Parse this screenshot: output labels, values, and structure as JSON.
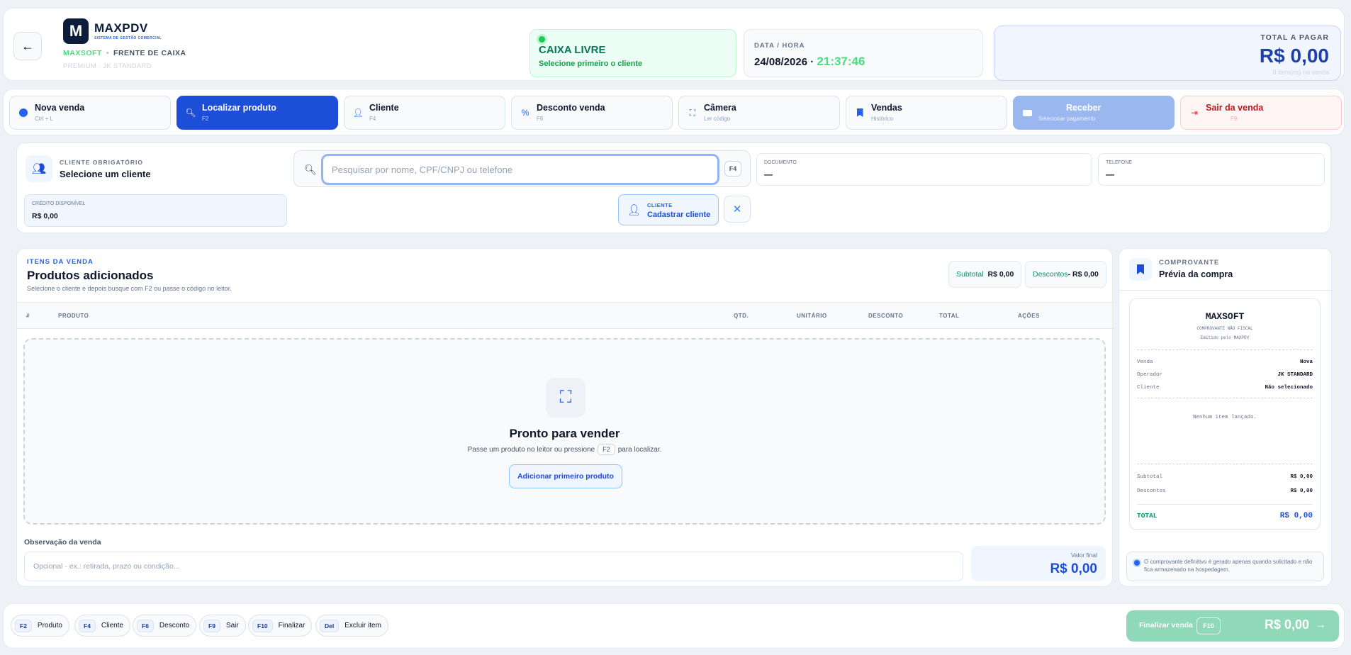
{
  "header": {
    "brand": "MAXPDV",
    "brand_sub": "SISTEMA DE GESTÃO COMERCIAL",
    "crumb_a": "MAXSOFT",
    "crumb_b": "FRENTE DE CAIXA",
    "plan": "PREMIUM · JK STANDARD",
    "status_title": "CAIXA LIVRE",
    "status_sub": "Selecione primeiro o cliente",
    "datetime_label": "DATA / HORA",
    "date": "24/08/2026 · ",
    "time": "21:37:46",
    "total_label": "TOTAL A PAGAR",
    "total_value": "R$ 0,00",
    "total_sub": "0 item(ns) na venda"
  },
  "toolbar": [
    {
      "label": "Nova venda",
      "shortcut": "Ctrl + L",
      "icon": "dot-icon"
    },
    {
      "label": "Localizar produto",
      "shortcut": "F2",
      "icon": "search-icon"
    },
    {
      "label": "Cliente",
      "shortcut": "F4",
      "icon": "user-icon"
    },
    {
      "label": "Desconto venda",
      "shortcut": "F6",
      "icon": "percent-icon"
    },
    {
      "label": "Câmera",
      "shortcut": "Ler código",
      "icon": "scan-icon"
    },
    {
      "label": "Vendas",
      "shortcut": "Histórico",
      "icon": "bookmark-icon"
    },
    {
      "label": "Receber",
      "shortcut": "Selecionar pagamento",
      "icon": "card-icon"
    },
    {
      "label": "Sair da venda",
      "shortcut": "F9",
      "icon": "exit-icon"
    }
  ],
  "client": {
    "label": "CLIENTE OBRIGATÓRIO",
    "value": "Selecione um cliente",
    "credit_label": "CRÉDITO DISPONÍVEL",
    "credit_value": "R$ 0,00",
    "search_placeholder": "Pesquisar por nome, CPF/CNPJ ou telefone",
    "search_key": "F4",
    "doc_label": "DOCUMENTO",
    "doc_value": "—",
    "phone_label": "TELEFONE",
    "phone_value": "—",
    "new_label": "CLIENTE",
    "new_value": "Cadastrar cliente"
  },
  "items": {
    "eyebrow": "ITENS DA VENDA",
    "title": "Produtos adicionados",
    "desc": "Selecione o cliente e depois busque com F2 ou passe o código no leitor.",
    "subtotal_label": "Subtotal",
    "subtotal_value": "R$ 0,00",
    "discount_label": "Descontos",
    "discount_value": "- R$ 0,00",
    "columns": [
      "#",
      "PRODUTO",
      "QTD.",
      "UNITÁRIO",
      "DESCONTO",
      "TOTAL",
      "AÇÕES"
    ],
    "empty_title": "Pronto para vender",
    "empty_pre": "Passe um produto no leitor ou pressione",
    "empty_key": "F2",
    "empty_post": "para localizar.",
    "empty_button": "Adicionar primeiro produto",
    "obs_label": "Observação da venda",
    "obs_placeholder": "Opcional · ex.: retirada, prazo ou condição...",
    "final_label": "Valor final",
    "final_value": "R$ 0,00"
  },
  "receipt": {
    "eyebrow": "COMPROVANTE",
    "title": "Prévia da compra",
    "company": "MAXSOFT",
    "sub1": "COMPROVANTE NÃO FISCAL",
    "sub2": "Emitido pelo MAXPDV",
    "rows": [
      {
        "k": "Venda",
        "v": "Nova"
      },
      {
        "k": "Operador",
        "v": "JK STANDARD"
      },
      {
        "k": "Cliente",
        "v": "Não selecionado"
      }
    ],
    "no_items": "Nenhum item lançado.",
    "subtotal_label": "Subtotal",
    "subtotal_value": "R$ 0,00",
    "discount_label": "Descontos",
    "discount_value": "R$ 0,00",
    "total_label": "TOTAL",
    "total_value": "R$ 0,00",
    "note": "O comprovante definitivo é gerado apenas quando solicitado e não fica armazenado na hospedagem."
  },
  "footer": {
    "shortcuts": [
      {
        "k": "F2",
        "label": "Produto"
      },
      {
        "k": "F4",
        "label": "Cliente"
      },
      {
        "k": "F6",
        "label": "Desconto"
      },
      {
        "k": "F9",
        "label": "Sair"
      },
      {
        "k": "F10",
        "label": "Finalizar"
      },
      {
        "k": "Del",
        "label": "Excluir item"
      }
    ],
    "finish_label": "Finalizar venda",
    "finish_key": "F10",
    "finish_value": "R$ 0,00"
  },
  "colors": {
    "accent": "#1d4ed8",
    "success": "#22c55e",
    "danger": "#dc2626"
  }
}
